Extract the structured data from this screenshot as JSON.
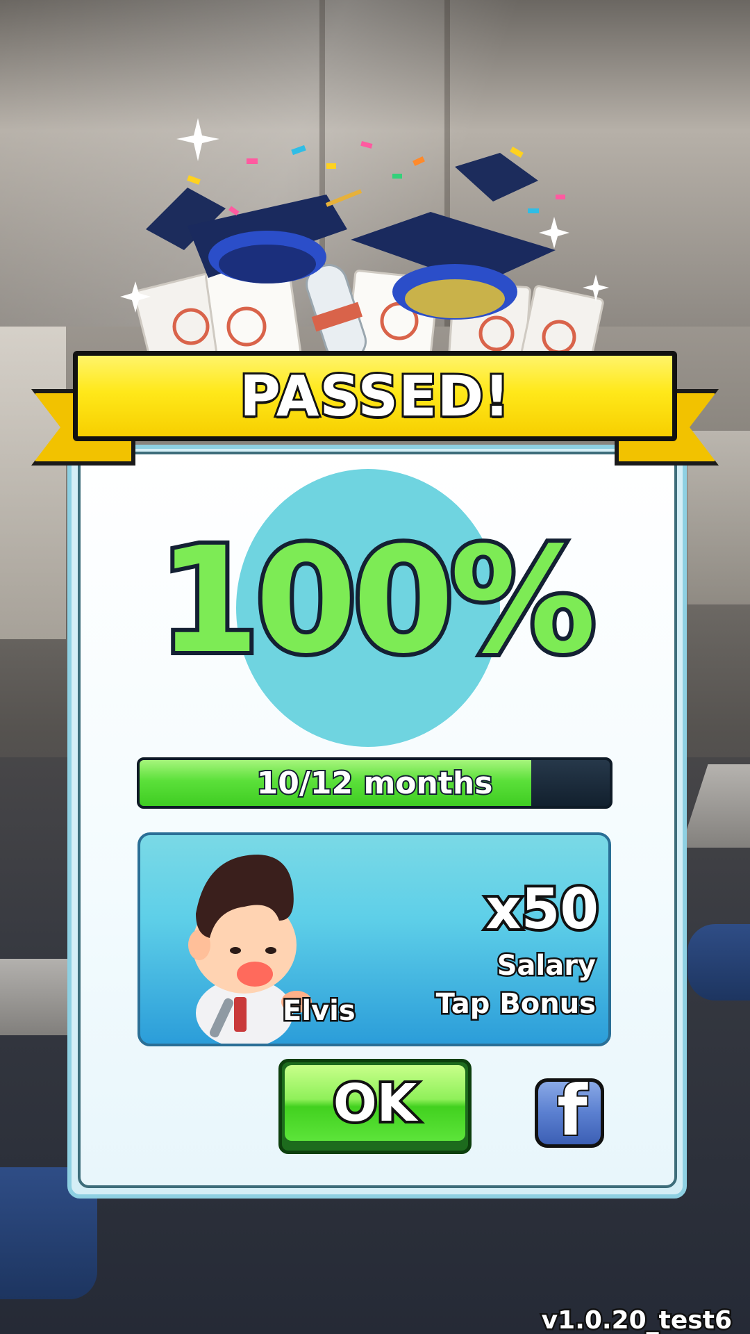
{
  "header": {
    "title": "PASSED!"
  },
  "score": {
    "percent_text": "100%"
  },
  "progress": {
    "label": "10/12 months",
    "completed": 10,
    "total": 12
  },
  "reward": {
    "character_name": "Elvis",
    "multiplier": "x50",
    "line1": "Salary",
    "line2": "Tap Bonus"
  },
  "buttons": {
    "ok_label": "OK",
    "facebook_glyph": "f"
  },
  "footer": {
    "version": "v1.0.20_test6"
  },
  "colors": {
    "ribbon_yellow": "#ffe81a",
    "score_green": "#7deb55",
    "score_circle": "#6fd4e0",
    "progress_green": "#5be03a",
    "facebook_blue": "#5a7fd0"
  },
  "icons": [
    "graduation-cap-icon",
    "diploma-icon",
    "sparkle-icon",
    "facebook-icon"
  ]
}
